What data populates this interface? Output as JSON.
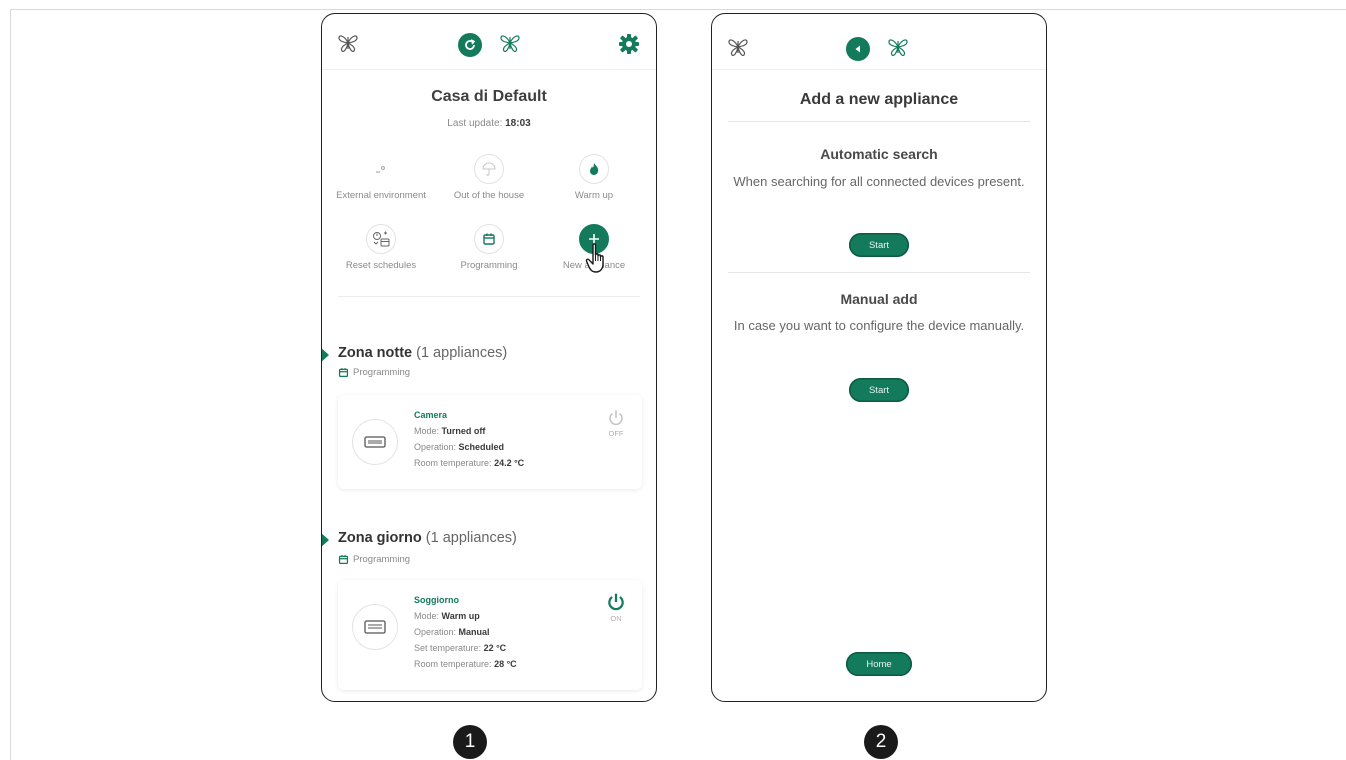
{
  "screen1": {
    "house_title": "Casa di Default",
    "last_update_label": "Last update:",
    "last_update_time": "18:03",
    "actions": [
      {
        "label": "External environment",
        "icon": "external-temp-icon"
      },
      {
        "label": "Out of the house",
        "icon": "umbrella-icon"
      },
      {
        "label": "Warm up",
        "icon": "flame-icon"
      },
      {
        "label": "Reset schedules",
        "icon": "reset-schedule-icon"
      },
      {
        "label": "Programming",
        "icon": "calendar-icon"
      },
      {
        "label": "New appliance",
        "icon": "plus-icon"
      }
    ],
    "zones": [
      {
        "name": "Zona notte",
        "count": "(1 appliances)",
        "sub": "Programming",
        "device": {
          "name": "Camera",
          "mode_label": "Mode:",
          "mode": "Turned off",
          "operation_label": "Operation:",
          "operation": "Scheduled",
          "room_temp_label": "Room temperature:",
          "room_temp": "24.2 °C",
          "power_state": "OFF"
        }
      },
      {
        "name": "Zona giorno",
        "count": "(1 appliances)",
        "sub": "Programming",
        "device": {
          "name": "Soggiorno",
          "mode_label": "Mode:",
          "mode": "Warm up",
          "operation_label": "Operation:",
          "operation": "Manual",
          "set_temp_label": "Set temperature:",
          "set_temp": "22 °C",
          "room_temp_label": "Room temperature:",
          "room_temp": "28 °C",
          "power_state": "ON"
        }
      }
    ]
  },
  "screen2": {
    "title": "Add a new appliance",
    "auto": {
      "title": "Automatic search",
      "text": "When searching for all connected devices present.",
      "button": "Start"
    },
    "manual": {
      "title": "Manual add",
      "text": "In case you want to configure the device manually.",
      "button": "Start"
    },
    "home_button": "Home"
  },
  "steps": [
    "1",
    "2"
  ],
  "colors": {
    "accent": "#147a5c",
    "text": "#3a3a3a",
    "muted": "#8a8a8a"
  }
}
